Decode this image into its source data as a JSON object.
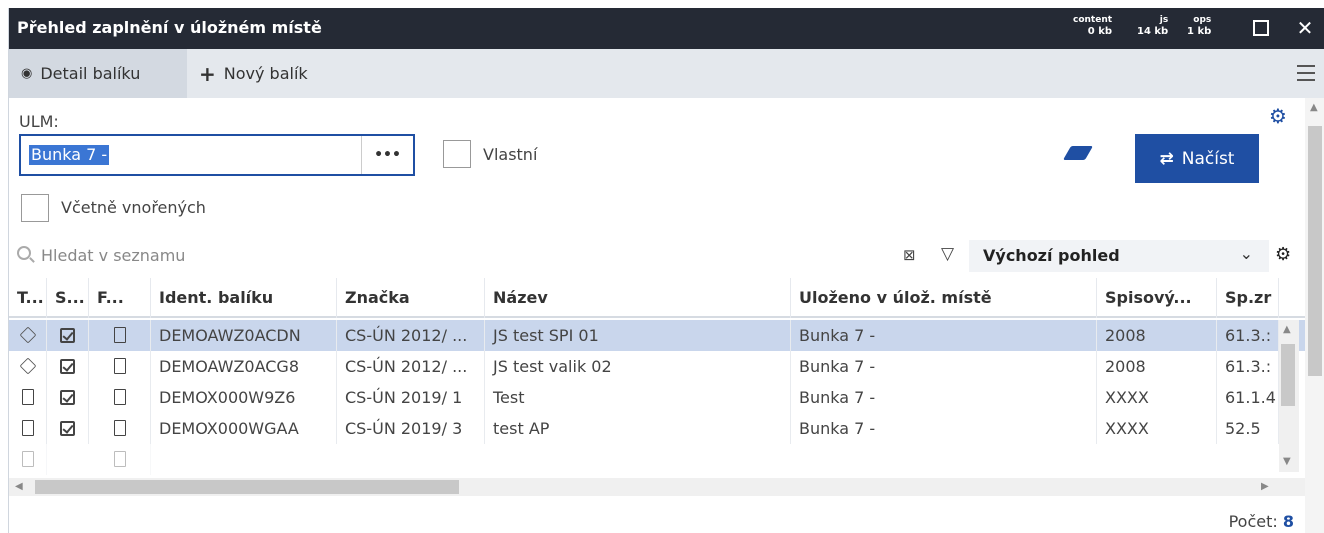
{
  "window": {
    "title": "Přehled zaplnění v úložném místě",
    "stats": [
      {
        "label": "content",
        "value": "0 kb"
      },
      {
        "label": "js",
        "value": "14 kb"
      },
      {
        "label": "ops",
        "value": "1 kb"
      }
    ]
  },
  "tabs": [
    {
      "label": "Detail balíku",
      "icon": "eye-icon"
    },
    {
      "label": "Nový balík",
      "icon": "plus-icon"
    }
  ],
  "form": {
    "ulm_label": "ULM:",
    "ulm_value": "Bunka 7 -",
    "ulm_dots": "•••",
    "own_label": "Vlastní",
    "nested_label": "Včetně vnořených",
    "load_label": "Načíst"
  },
  "search": {
    "placeholder": "Hledat v seznamu",
    "view_value": "Výchozí pohled"
  },
  "grid": {
    "headers": [
      "T...",
      "S...",
      "F...",
      "Ident. balíku",
      "Značka",
      "Název",
      "Uloženo v úlož. místě",
      "Spisový...",
      "Sp.zr"
    ],
    "rows": [
      {
        "type": "cube",
        "checked": true,
        "file": "H",
        "ident": "DEMOAWZ0ACDN",
        "mark": "CS-ÚN 2012/ ...",
        "name": "JS test SPI 01",
        "stored": "Bunka 7 -",
        "year": "2008",
        "spzr": "61.3.:",
        "selected": true
      },
      {
        "type": "cube",
        "checked": true,
        "file": "H",
        "ident": "DEMOAWZ0ACG8",
        "mark": "CS-ÚN 2012/ ...",
        "name": "JS test valik 02",
        "stored": "Bunka 7 -",
        "year": "2008",
        "spzr": "61.3.:",
        "selected": false
      },
      {
        "type": "doc",
        "checked": true,
        "file": "",
        "ident": "DEMOX000W9Z6",
        "mark": "CS-ÚN 2019/ 1",
        "name": "Test",
        "stored": "Bunka 7 -",
        "year": "XXXX",
        "spzr": "61.1.4",
        "selected": false
      },
      {
        "type": "doc",
        "checked": true,
        "file": "",
        "ident": "DEMOX000WGAA",
        "mark": "CS-ÚN 2019/ 3",
        "name": "test AP",
        "stored": "Bunka 7 -",
        "year": "XXXX",
        "spzr": "52.5",
        "selected": false
      }
    ]
  },
  "footer": {
    "count_label": "Počet:",
    "count_value": "8"
  }
}
